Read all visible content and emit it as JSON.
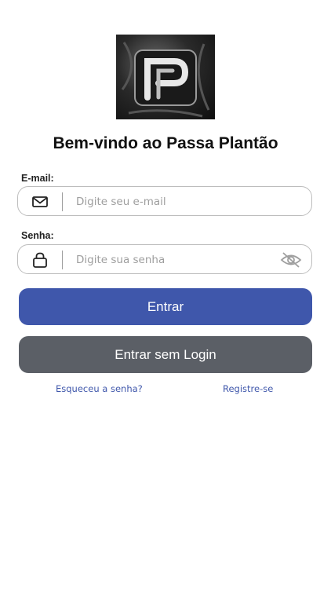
{
  "header": {
    "title": "Bem-vindo ao Passa Plantão",
    "logo_icon": "passa-plantao-logo"
  },
  "email": {
    "label": "E-mail:",
    "placeholder": "Digite seu e-mail",
    "value": "",
    "icon": "mail-icon"
  },
  "password": {
    "label": "Senha:",
    "placeholder": "Digite sua senha",
    "value": "",
    "icon": "lock-icon",
    "toggle_icon": "eye-off-icon"
  },
  "actions": {
    "login_label": "Entrar",
    "guest_label": "Entrar sem Login",
    "forgot_label": "Esqueceu a senha?",
    "register_label": "Registre-se"
  },
  "colors": {
    "primary": "#3f57ab",
    "secondary": "#5b5f66",
    "link": "#3f57ab"
  }
}
